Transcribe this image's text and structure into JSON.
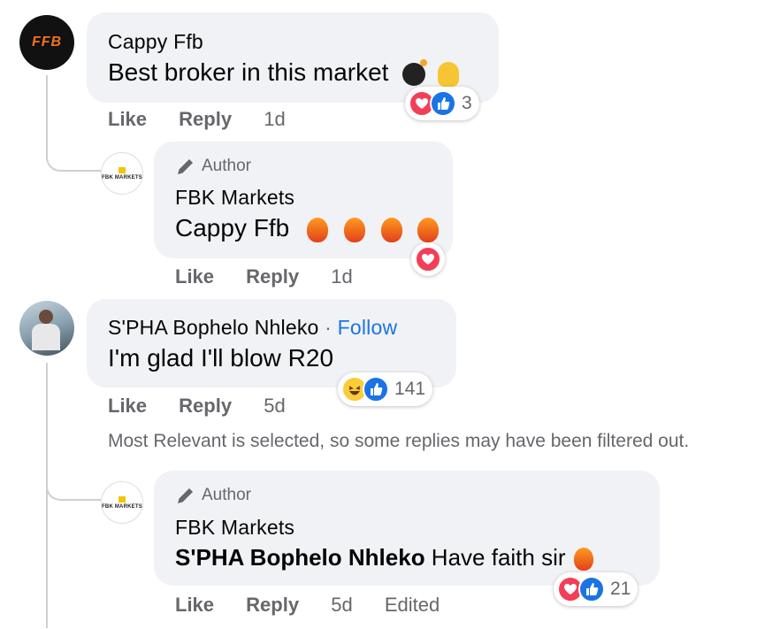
{
  "comments": [
    {
      "author": "Cappy Ffb",
      "avatar_text": "FFB",
      "text_plain": "Best broker in this market",
      "emojis": [
        "bomb",
        "pinching-hand"
      ],
      "reactions": [
        "love",
        "like"
      ],
      "reaction_count": "3",
      "actions": {
        "like": "Like",
        "reply": "Reply",
        "time": "1d"
      }
    },
    {
      "badge": "Author",
      "author": "FBK Markets",
      "avatar_text": "FBK MARKETS",
      "mention": "Cappy Ffb",
      "emojis": [
        "fire",
        "fire",
        "fire",
        "fire"
      ],
      "reactions": [
        "love"
      ],
      "actions": {
        "like": "Like",
        "reply": "Reply",
        "time": "1d"
      }
    },
    {
      "author": "S'PHA Bophelo Nhleko",
      "separator": "·",
      "follow": "Follow",
      "text_plain": "I'm glad I'll blow R20",
      "reactions": [
        "haha",
        "like"
      ],
      "reaction_count": "141",
      "actions": {
        "like": "Like",
        "reply": "Reply",
        "time": "5d"
      }
    },
    {
      "notice": "Most Relevant is selected, so some replies may have been filtered out."
    },
    {
      "badge": "Author",
      "author": "FBK Markets",
      "avatar_text": "FBK MARKETS",
      "mention": "S'PHA Bophelo Nhleko",
      "text_plain": " Have faith sir",
      "emojis": [
        "fire"
      ],
      "reactions": [
        "love",
        "like"
      ],
      "reaction_count": "21",
      "actions": {
        "like": "Like",
        "reply": "Reply",
        "time": "5d",
        "edited": "Edited"
      }
    }
  ],
  "colors": {
    "bubble": "#f0f2f5",
    "love": "#f33e58",
    "like": "#1b74e4",
    "link": "#1b74e4",
    "meta": "#65676b"
  }
}
